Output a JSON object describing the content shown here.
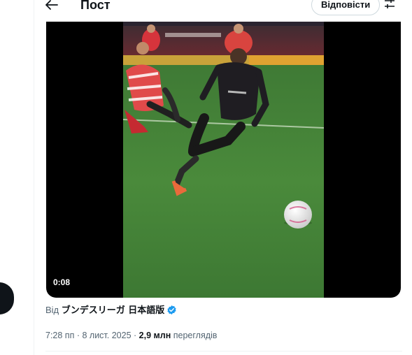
{
  "header": {
    "title": "Пост",
    "reply_label": "Відповісти",
    "back_icon": "arrow-left-icon",
    "settings_icon": "sliders-icon"
  },
  "video": {
    "elapsed": "0:08"
  },
  "attribution": {
    "prefix": "Від",
    "account_name": "ブンデスリーガ 日本語版",
    "verified_icon": "verified-badge-icon",
    "verified_color": "#1d9bf0"
  },
  "meta": {
    "time": "7:28 пп",
    "separator1": "·",
    "date": "8 лист. 2025",
    "separator2": "·",
    "views_count": "2,9 млн",
    "views_label": "переглядів"
  },
  "colors": {
    "text_primary": "#0f1419",
    "text_secondary": "#536471",
    "border": "#cfd9de",
    "accent": "#1d9bf0"
  }
}
